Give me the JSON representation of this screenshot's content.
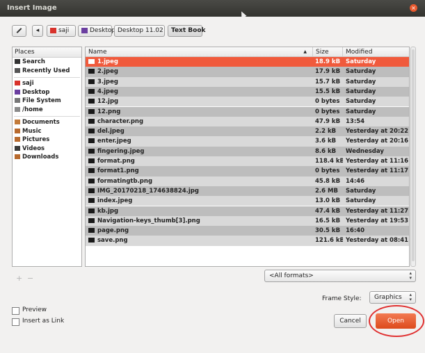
{
  "window": {
    "title": "Insert Image",
    "close_glyph": "×"
  },
  "pathbar": {
    "edit_icon": "pencil-icon",
    "back_glyph": "◂",
    "crumbs": [
      {
        "label": "saji",
        "icon": "home-folder-icon",
        "color": "#d8322b"
      },
      {
        "label": "Desktop",
        "icon": "desktop-icon",
        "color": "#6b3fa0"
      },
      {
        "label": "Desktop 11.02"
      },
      {
        "label": "Text Book",
        "active": true
      }
    ]
  },
  "places": {
    "header": "Places",
    "items": [
      {
        "label": "Search",
        "icon": "search-icon",
        "color": "#333333"
      },
      {
        "label": "Recently Used",
        "icon": "clock-icon",
        "color": "#555555"
      },
      {
        "sep": true
      },
      {
        "label": "saji",
        "icon": "home-folder-icon",
        "color": "#d8322b"
      },
      {
        "label": "Desktop",
        "icon": "desktop-icon",
        "color": "#6b3fa0"
      },
      {
        "label": "File System",
        "icon": "drive-icon",
        "color": "#777777"
      },
      {
        "label": "/home",
        "icon": "folder-icon",
        "color": "#8a8a8a"
      },
      {
        "sep": true
      },
      {
        "label": "Documents",
        "icon": "documents-folder-icon",
        "color": "#c27a3a"
      },
      {
        "label": "Music",
        "icon": "music-folder-icon",
        "color": "#b86a2e"
      },
      {
        "label": "Pictures",
        "icon": "pictures-folder-icon",
        "color": "#b86a2e"
      },
      {
        "label": "Videos",
        "icon": "videos-folder-icon",
        "color": "#3a3a3a"
      },
      {
        "label": "Downloads",
        "icon": "downloads-folder-icon",
        "color": "#b86a2e"
      }
    ]
  },
  "files": {
    "columns": {
      "name": "Name",
      "size": "Size",
      "modified": "Modified",
      "sort_glyph": "▲"
    },
    "rows": [
      {
        "name": "1.jpeg",
        "size": "18.9 kB",
        "modified": "Saturday",
        "selected": true
      },
      {
        "name": "2.jpeg",
        "size": "17.9 kB",
        "modified": "Saturday"
      },
      {
        "name": "3.jpeg",
        "size": "15.7 kB",
        "modified": "Saturday"
      },
      {
        "name": "4.jpeg",
        "size": "15.5 kB",
        "modified": "Saturday"
      },
      {
        "name": "12.jpg",
        "size": "0 bytes",
        "modified": "Saturday"
      },
      {
        "name": "12.png",
        "size": "0 bytes",
        "modified": "Saturday"
      },
      {
        "name": "character.png",
        "size": "47.9 kB",
        "modified": "13:54"
      },
      {
        "name": "del.jpeg",
        "size": "2.2 kB",
        "modified": "Yesterday at 20:22"
      },
      {
        "name": "enter.jpeg",
        "size": "3.6 kB",
        "modified": "Yesterday at 20:16"
      },
      {
        "name": "fingering.jpeg",
        "size": "8.6 kB",
        "modified": "Wednesday"
      },
      {
        "name": "format.png",
        "size": "118.4 kB",
        "modified": "Yesterday at 11:16"
      },
      {
        "name": "format1.png",
        "size": "0 bytes",
        "modified": "Yesterday at 11:17"
      },
      {
        "name": "formatingtb.png",
        "size": "45.8 kB",
        "modified": "14:46"
      },
      {
        "name": "IMG_20170218_174638824.jpg",
        "size": "2.6 MB",
        "modified": "Saturday"
      },
      {
        "name": "index.jpeg",
        "size": "13.0 kB",
        "modified": "Saturday"
      },
      {
        "name": "kb.jpg",
        "size": "47.4 kB",
        "modified": "Yesterday at 11:27"
      },
      {
        "name": "Navigation-keys_thumb[3].png",
        "size": "16.5 kB",
        "modified": "Yesterday at 19:53"
      },
      {
        "name": "page.png",
        "size": "30.5 kB",
        "modified": "16:40"
      },
      {
        "name": "save.png",
        "size": "121.6 kB",
        "modified": "Yesterday at 08:41"
      }
    ]
  },
  "sidebar_controls": {
    "add": "+",
    "remove": "−"
  },
  "filter": {
    "value": "<All formats>"
  },
  "frame_style": {
    "label": "Frame Style:",
    "value": "Graphics"
  },
  "options": {
    "preview": "Preview",
    "insert_as_link": "Insert as Link"
  },
  "actions": {
    "cancel": "Cancel",
    "open": "Open"
  },
  "colors": {
    "accent": "#f05a3c",
    "annotation_ring": "#e03030"
  }
}
